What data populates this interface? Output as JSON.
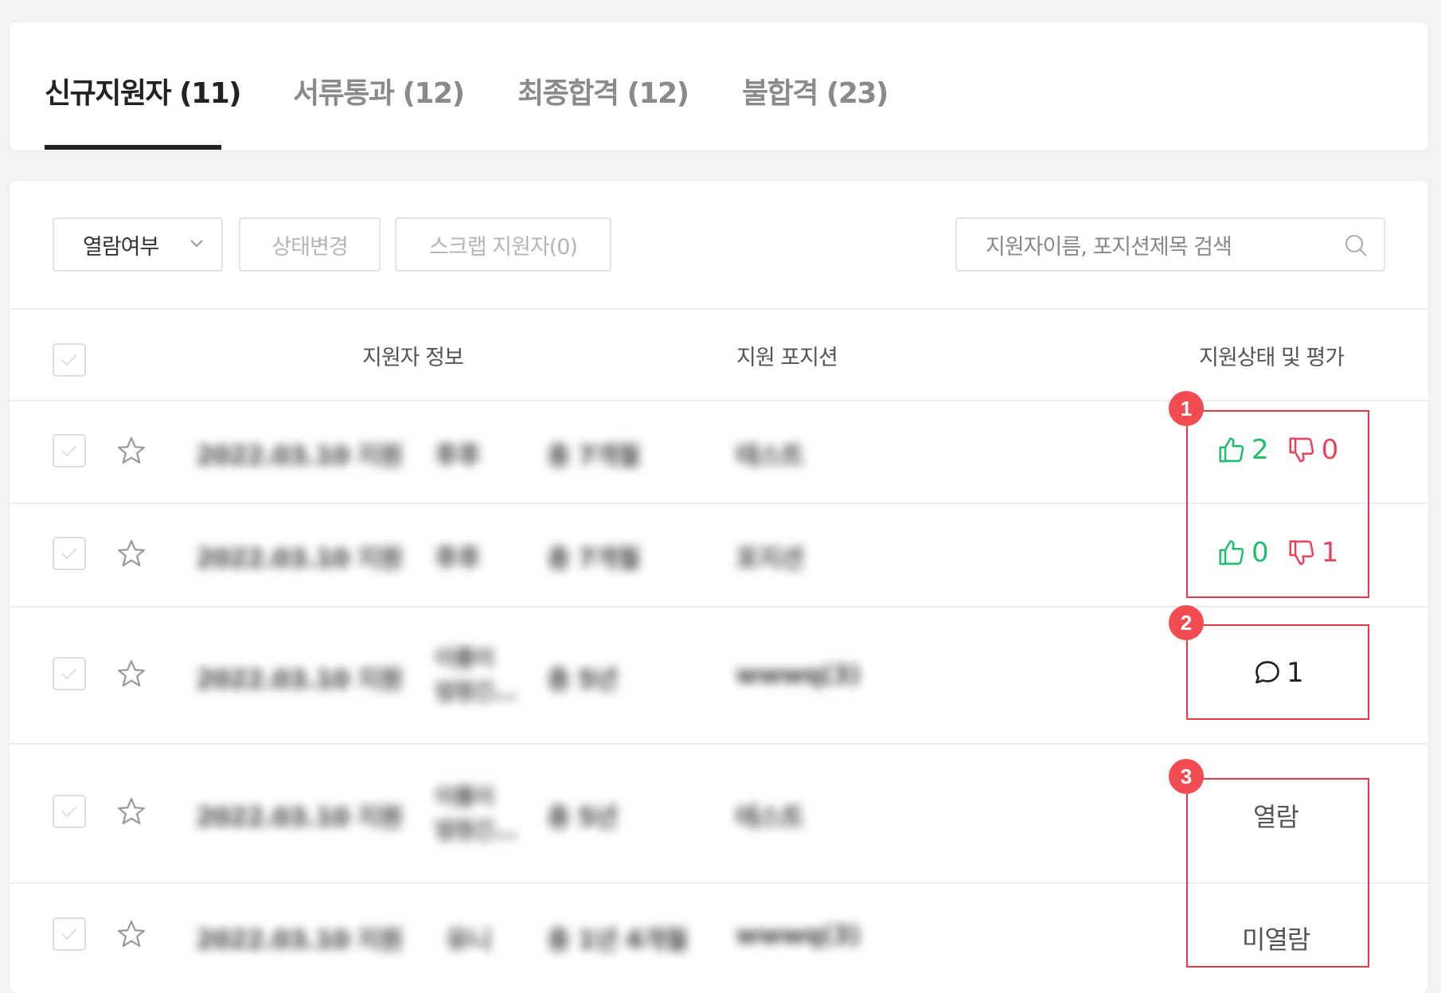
{
  "tabs": [
    {
      "label": "신규지원자 (11)",
      "active": true
    },
    {
      "label": "서류통과 (12)",
      "active": false
    },
    {
      "label": "최종합격 (12)",
      "active": false
    },
    {
      "label": "불합격 (23)",
      "active": false
    }
  ],
  "toolbar": {
    "filter_label": "열람여부",
    "status_change_label": "상태변경",
    "scrap_label": "스크랩 지원자(0)",
    "search_placeholder": "지원자이름, 포지션제목 검색"
  },
  "table": {
    "headers": {
      "applicant_info": "지원자 정보",
      "position": "지원 포지션",
      "status_eval": "지원상태 및 평가"
    },
    "rows": [
      {
        "date": "2022.03.10 지원",
        "name": "후후",
        "career": "총 7개월",
        "position": "테스트",
        "eval": {
          "up": "2",
          "down": "0"
        }
      },
      {
        "date": "2022.03.10 지원",
        "name": "후후",
        "career": "총 7개월",
        "position": "포지션",
        "eval": {
          "up": "0",
          "down": "1"
        }
      },
      {
        "date": "2022.03.10 지원",
        "name_line1": "이름이",
        "name_line2": "엄청긴...",
        "career": "총 5년",
        "position": "wwwq(3)",
        "comments": "1"
      },
      {
        "date": "2022.03.10 지원",
        "name_line1": "이름이",
        "name_line2": "엄청긴...",
        "career": "총 5년",
        "position": "테스트",
        "state": "열람"
      },
      {
        "date": "2022.03.10 지원",
        "name": "유니",
        "career": "총 1년 4개월",
        "position": "wwwq(3)",
        "state": "미열람"
      }
    ]
  },
  "markers": [
    "1",
    "2",
    "3"
  ],
  "colors": {
    "thumbs_up": "#1dc06a",
    "thumbs_down": "#e9435b",
    "marker": "#f24c52",
    "highlight_box": "#e53946"
  }
}
